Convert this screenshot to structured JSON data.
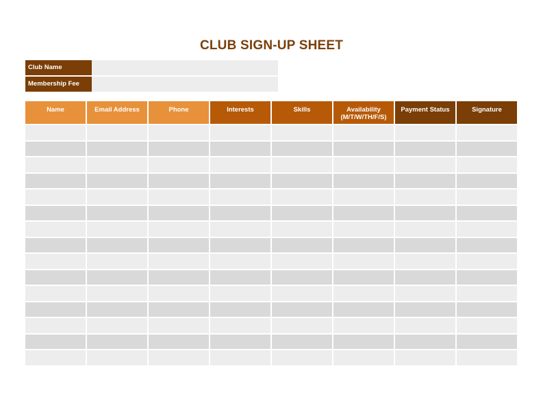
{
  "title": "CLUB SIGN-UP SHEET",
  "info_fields": [
    {
      "label": "Club Name",
      "value": ""
    },
    {
      "label": "Membership Fee",
      "value": ""
    }
  ],
  "table": {
    "columns": [
      {
        "label": "Name",
        "sub": "",
        "tone": "light"
      },
      {
        "label": "Email Address",
        "sub": "",
        "tone": "light"
      },
      {
        "label": "Phone",
        "sub": "",
        "tone": "light"
      },
      {
        "label": "Interests",
        "sub": "",
        "tone": "mid"
      },
      {
        "label": "Skills",
        "sub": "",
        "tone": "mid"
      },
      {
        "label": "Availability",
        "sub": "(M/T/W/TH/F/S)",
        "tone": "mid"
      },
      {
        "label": "Payment Status",
        "sub": "",
        "tone": "dark"
      },
      {
        "label": "Signature",
        "sub": "",
        "tone": "dark"
      }
    ],
    "row_count": 15
  },
  "colors": {
    "title": "#7b3f0a",
    "header_light": "#e8913b",
    "header_mid": "#b65a08",
    "header_dark": "#7a3e06",
    "row_light": "#ededed",
    "row_dark": "#d9d9d9"
  }
}
